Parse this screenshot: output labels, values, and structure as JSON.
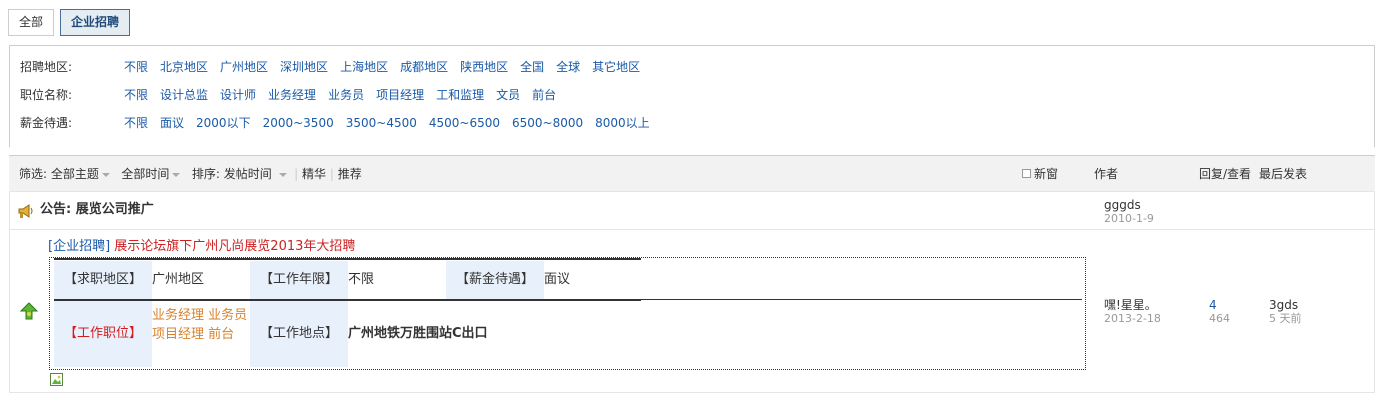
{
  "tabs": [
    {
      "label": "全部",
      "active": false
    },
    {
      "label": "企业招聘",
      "active": true
    }
  ],
  "filters": {
    "region": {
      "label": "招聘地区:",
      "options": [
        "不限",
        "北京地区",
        "广州地区",
        "深圳地区",
        "上海地区",
        "成都地区",
        "陕西地区",
        "全国",
        "全球",
        "其它地区"
      ]
    },
    "position": {
      "label": "职位名称:",
      "options": [
        "不限",
        "设计总监",
        "设计师",
        "业务经理",
        "业务员",
        "项目经理",
        "工和监理",
        "文员",
        "前台"
      ]
    },
    "salary": {
      "label": "薪金待遇:",
      "options": [
        "不限",
        "面议",
        "2000以下",
        "2000~3500",
        "3500~4500",
        "4500~6500",
        "6500~8000",
        "8000以上"
      ]
    }
  },
  "listhead": {
    "filter_label": "筛选:",
    "all_topics": "全部主题",
    "all_time": "全部时间",
    "sort_label": "排序:",
    "sort_value": "发帖时间",
    "digest": "精华",
    "recommend": "推荐",
    "new_window": "新窗",
    "col_author": "作者",
    "col_replies": "回复/查看",
    "col_last": "最后发表"
  },
  "announcement": {
    "prefix": "公告:",
    "title": "展览公司推广",
    "author": "gggds",
    "date": "2010-1-9"
  },
  "thread": {
    "category": "[企业招聘]",
    "subject": "展示论坛旗下广州凡尚展览2013年大招聘",
    "info": {
      "region_label": "【求职地区】",
      "region_value": "广州地区",
      "years_label": "【工作年限】",
      "years_value": "不限",
      "salary_label": "【薪金待遇】",
      "salary_value": "面议",
      "position_label": "【工作职位】",
      "position_value": "业务经理 业务员 项目经理 前台",
      "location_label": "【工作地点】",
      "location_value": "广州地铁万胜围站C出口"
    },
    "author": "嘿!星星。",
    "date": "2013-2-18",
    "replies": "4",
    "views": "464",
    "last_author": "3gds",
    "last_time": "5 天前"
  },
  "colors": {
    "link": "#1a5aa7",
    "subject_red": "#cc2222",
    "position_orange": "#d9822b",
    "label_bg": "#e8f0fb",
    "header_bg": "#f2f2f2"
  }
}
